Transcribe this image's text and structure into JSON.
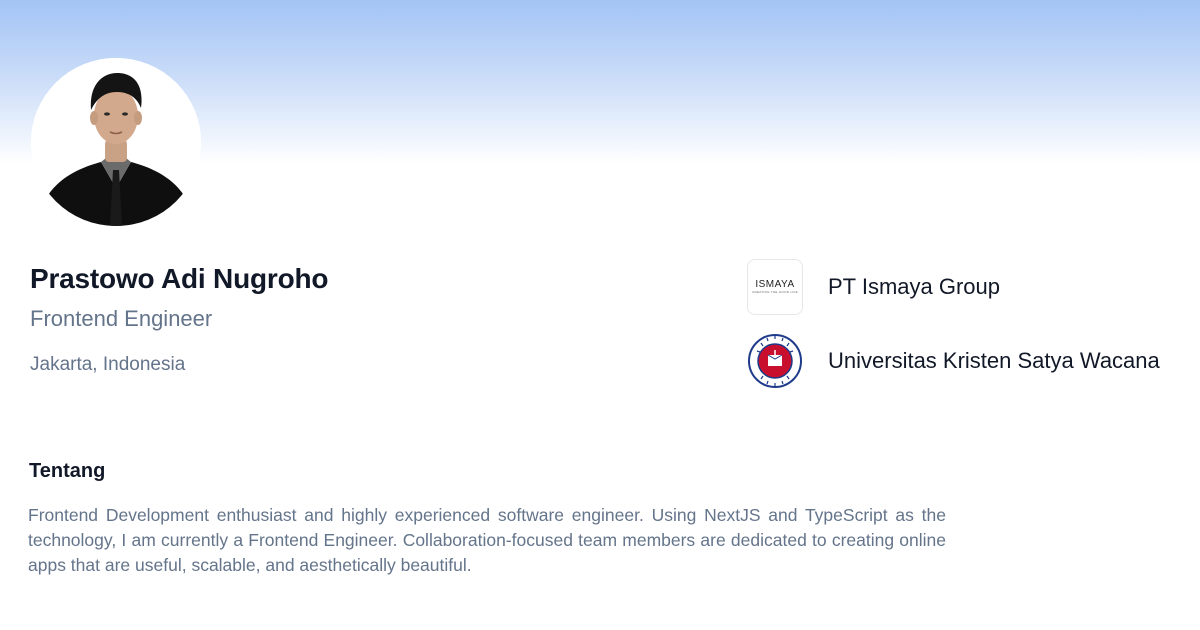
{
  "profile": {
    "name": "Prastowo Adi Nugroho",
    "role": "Frontend Engineer",
    "location": "Jakarta, Indonesia",
    "avatar_icon": "avatar-photo"
  },
  "organizations": [
    {
      "name": "PT Ismaya Group",
      "logo": "ismaya-logo",
      "logo_text": "ISMAYA",
      "logo_tagline": "CREATING THE GOOD LIFE"
    },
    {
      "name": "Universitas Kristen Satya Wacana",
      "logo": "uksw-seal-logo",
      "logo_text": "UNIVERSITAS KRISTEN SATYA WACANA"
    }
  ],
  "about": {
    "title": "Tentang",
    "text": "Frontend Development enthusiast and highly experienced software engineer. Using NextJS and TypeScript as the technology, I am currently a Frontend Engineer. Collaboration-focused team members are dedicated to creating online apps that are useful, scalable, and aesthetically beautiful."
  },
  "colors": {
    "banner_top": "#a3c4f5",
    "text_primary": "#111827",
    "text_muted": "#64748b",
    "uksw_red": "#c8102e"
  }
}
